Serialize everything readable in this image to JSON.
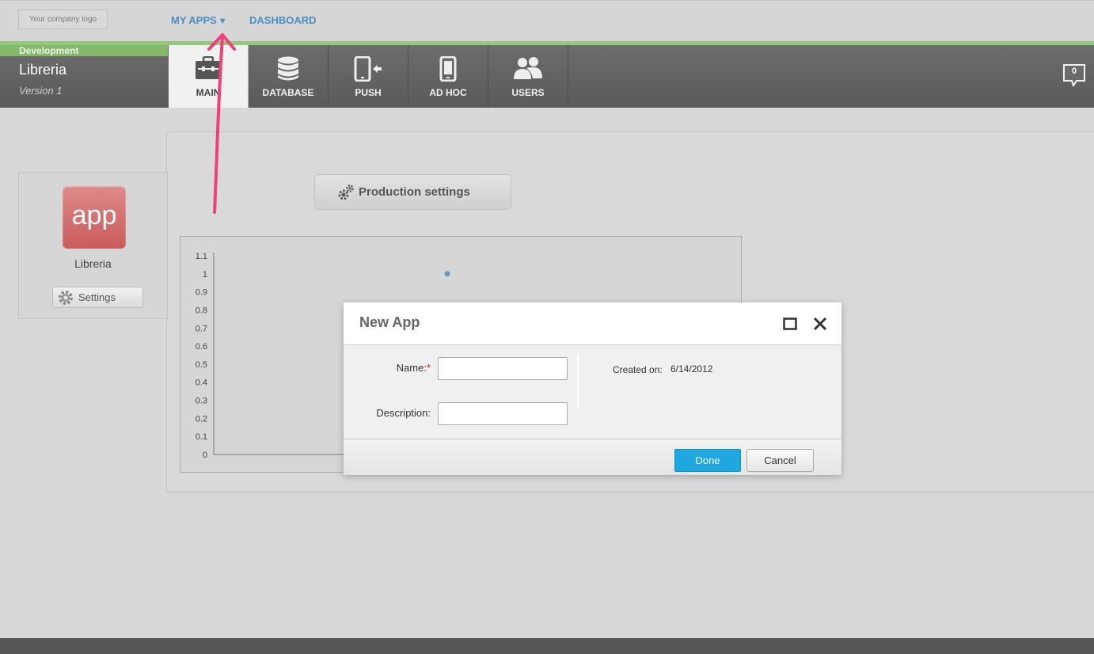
{
  "header": {
    "logo_text": "Your company logo",
    "nav": [
      {
        "label": "MY APPS",
        "caret": "▼"
      },
      {
        "label": "DASHBOARD"
      }
    ]
  },
  "app": {
    "environment": "Development",
    "name": "Libreria",
    "version": "Version 1"
  },
  "tabs": [
    {
      "label": "MAIN",
      "icon": "briefcase-icon",
      "active": true
    },
    {
      "label": "DATABASE",
      "icon": "database-icon",
      "active": false
    },
    {
      "label": "PUSH",
      "icon": "phone-push-icon",
      "active": false
    },
    {
      "label": "AD HOC",
      "icon": "phone-icon",
      "active": false
    },
    {
      "label": "USERS",
      "icon": "users-icon",
      "active": false
    }
  ],
  "notifications": {
    "count": "0"
  },
  "sidebar": {
    "icon_text": "app",
    "app_name": "Libreria",
    "settings_label": "Settings"
  },
  "main": {
    "production_settings_label": "Production settings"
  },
  "chart_data": {
    "type": "scatter",
    "title": "",
    "xlabel": "",
    "ylabel": "",
    "ylim": [
      0,
      1.1
    ],
    "yticks": [
      "1.1",
      "1",
      "0.9",
      "0.8",
      "0.7",
      "0.6",
      "0.5",
      "0.4",
      "0.3",
      "0.2",
      "0.1",
      "0"
    ],
    "series": [
      {
        "values": [
          1
        ]
      }
    ],
    "grid": false
  },
  "modal": {
    "title": "New App",
    "name_label": "Name:",
    "name_required": "*",
    "name_value": "",
    "description_label": "Description:",
    "description_value": "",
    "created_label": "Created on:",
    "created_value": "6/14/2012",
    "done_label": "Done",
    "cancel_label": "Cancel"
  },
  "colors": {
    "accent_blue": "#1fa7e0",
    "nav_link": "#4a8fc0",
    "env_green": "#84b86a",
    "annotation_arrow": "#f0407a"
  }
}
